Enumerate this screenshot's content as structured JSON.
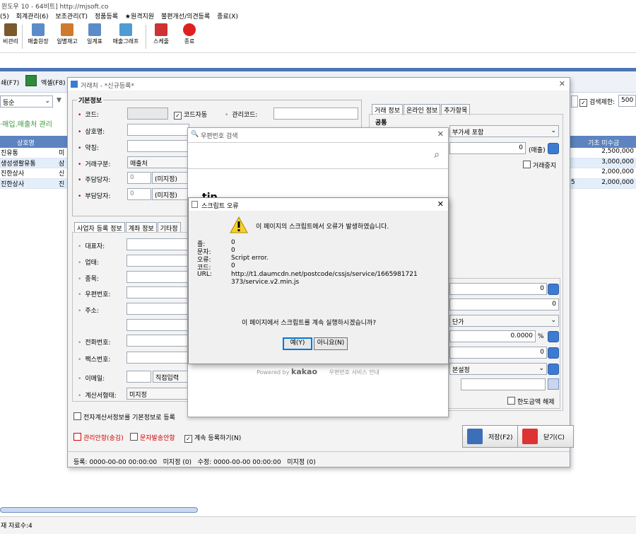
{
  "window_title": "윈도우 10 - 64비트]  http://mjsoft.co",
  "menu": [
    "(5)",
    "회계관리(6)",
    "보조관리(T)",
    "정품등록",
    "★원격지원",
    "불편개선/의견등록",
    "종료(X)"
  ],
  "toolbar": {
    "buttons": [
      "비관리",
      "매출원장",
      "일별재고",
      "일계표",
      "매출그래프",
      "스케줄",
      "종료"
    ]
  },
  "bg": {
    "excel1": "쇄(F7)",
    "excel2": "엑셀(F8)",
    "sort_select": "등순",
    "section_title": "·매입.매출처 관리",
    "search_limit_label": "검색제한:",
    "search_limit_value": "500",
    "grid_header_name": "상호명",
    "grid_header_due": "기초 미수금",
    "rows": [
      {
        "name": "진유통",
        "c2": "미",
        "due": "2,500,000"
      },
      {
        "name": "생성생활유통",
        "c2": "삼",
        "due": "3,000,000"
      },
      {
        "name": "진한상사",
        "c2": "신",
        "due": "2,000,000"
      },
      {
        "name": "진한상사",
        "c2": "진",
        "due": "2,000,000",
        "c3": "5"
      }
    ],
    "record_count": "재 자료수:4"
  },
  "dialog": {
    "title": "거래처 - *신규등록*",
    "basic_info": "기본정보",
    "code_label": "코드:",
    "auto_code": "코드자동",
    "mgmt_code_label": "관리코드:",
    "company_label": "상호명:",
    "abbr_label": "약칭:",
    "trade_type_label": "거래구분:",
    "trade_type_value": "매출처",
    "manager1_label": "주담당자:",
    "manager1_code": "0",
    "manager1_value": "(미지정)",
    "manager2_label": "부담당자:",
    "manager2_code": "0",
    "manager2_value": "(미지정)",
    "tabs_left": [
      "사업자 등록 정보",
      "계좌 정보",
      "기타정"
    ],
    "rep_label": "대표자:",
    "biz_label": "업태:",
    "item_label": "종목:",
    "zip_label": "우편번호:",
    "addr_label": "주소:",
    "phone_label": "전화번호:",
    "fax_label": "팩스번호:",
    "email_label": "이메일:",
    "email_direct": "직접입력",
    "invoice_label": "계산서형태:",
    "invoice_value": "미지정",
    "e_invoice": "전자계산서정보를 기본정보로 등록",
    "mgmt_notes": "관리안항(송김)",
    "sms_notes": "문자발송안항",
    "continue_reg": "계속 등록하기(N)",
    "tabs_right": [
      "거래 정보",
      "온라인 정보",
      "추가항목"
    ],
    "common_label": "공통",
    "tax_select": "부가세 포함",
    "sales_value": "0",
    "sales_unit": "(매출)",
    "stop_trade": "거래중지",
    "r_val1": "0",
    "r_val2": "0",
    "price_select": "단가",
    "rate_value": "0.0000",
    "rate_unit": "%",
    "r_val3": "0",
    "setting_select": "본설정",
    "limit_release": "한도금액 해제",
    "save_btn": "저장(F2)",
    "close_btn": "닫기(C)",
    "status": "등록: 0000-00-00 00:00:00   미지정 (0)   수정: 0000-00-00 00:00:00   미지정 (0)"
  },
  "postcode": {
    "title": "우편번호 검색",
    "tip": "tip",
    "powered": "Powered by",
    "kakao": "kakao",
    "service": "우편번호 서비스 안내"
  },
  "error": {
    "title": "스크립트 오류",
    "message": "이 페이지의 스크립트에서 오류가 발생하였습니다.",
    "line_label": "줄:",
    "line_value": "0",
    "char_label": "문자:",
    "char_value": "0",
    "err_label": "오류:",
    "err_value": "Script error.",
    "code_label": "코드:",
    "code_value": "0",
    "url_label": "URL:",
    "url_value1": "http://t1.daumcdn.net/postcode/cssjs/service/1665981721",
    "url_value2": "373/service.v2.min.js",
    "question": "이 페이지에서 스크립트를 계속 실행하시겠습니까?",
    "yes": "예(Y)",
    "no": "아니요(N)"
  },
  "colors": {
    "accent": "#4a76b5",
    "grid_header": "#5d84c0",
    "required": "#d20000"
  }
}
